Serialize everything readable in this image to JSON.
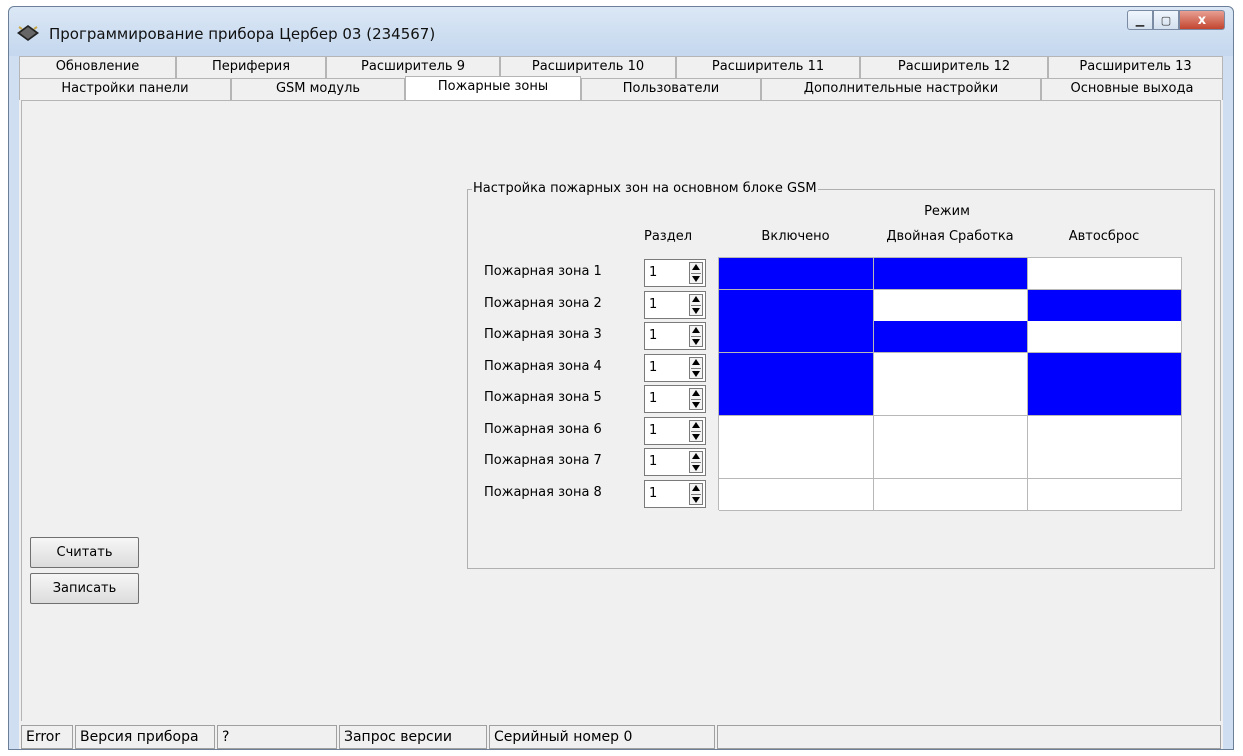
{
  "window": {
    "title": "Программирование прибора Цербер 03 (234567)",
    "close_symbol": "x"
  },
  "tabs_row1": [
    "Обновление",
    "Периферия",
    "Расширитель 9",
    "Расширитель 10",
    "Расширитель 11",
    "Расширитель 12",
    "Расширитель 13"
  ],
  "tabs_row2": [
    "Настройки панели",
    "GSM модуль",
    "Пожарные зоны",
    "Пользователи",
    "Дополнительные настройки",
    "Основные выхода"
  ],
  "active_tab": "Пожарные зоны",
  "group": {
    "title": "Настройка пожарных зон на основном блоке GSM",
    "mode_header": "Режим",
    "section_header": "Раздел",
    "columns": [
      "Включено",
      "Двойная Сработка",
      "Автосброс"
    ]
  },
  "zones": [
    {
      "label": "Пожарная зона 1",
      "section": "1",
      "flags": [
        true,
        true,
        false
      ]
    },
    {
      "label": "Пожарная зона 2",
      "section": "1",
      "flags": [
        true,
        false,
        true
      ]
    },
    {
      "label": "Пожарная зона 3",
      "section": "1",
      "flags": [
        true,
        true,
        false
      ]
    },
    {
      "label": "Пожарная зона 4",
      "section": "1",
      "flags": [
        true,
        false,
        true
      ]
    },
    {
      "label": "Пожарная зона 5",
      "section": "1",
      "flags": [
        true,
        false,
        true
      ]
    },
    {
      "label": "Пожарная зона 6",
      "section": "1",
      "flags": [
        false,
        false,
        false
      ]
    },
    {
      "label": "Пожарная зона 7",
      "section": "1",
      "flags": [
        false,
        false,
        false
      ]
    },
    {
      "label": "Пожарная зона 8",
      "section": "1",
      "flags": [
        false,
        false,
        false
      ]
    }
  ],
  "buttons": {
    "read": "Считать",
    "write": "Записать"
  },
  "statusbar": [
    "Error",
    "Версия прибора",
    "?",
    "Запрос версии",
    "Серийный номер 0",
    ""
  ],
  "colors": {
    "on": "#0000ff",
    "off": "#ffffff",
    "accent": "#cfdff1"
  }
}
